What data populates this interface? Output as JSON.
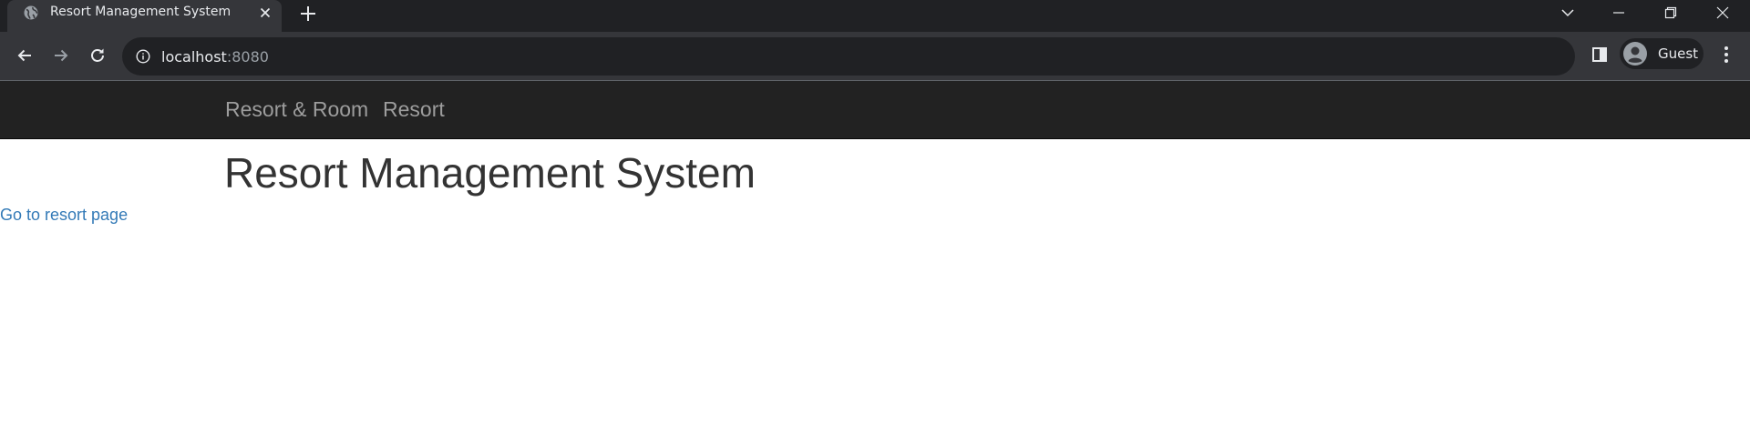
{
  "browser": {
    "tab": {
      "title": "Resort Management System",
      "favicon": "globe-icon"
    },
    "address": {
      "host": "localhost",
      "port": ":8080"
    },
    "profile": {
      "name": "Guest"
    },
    "icons": {
      "back": "arrow-left-icon",
      "forward": "arrow-right-icon",
      "reload": "reload-icon",
      "info": "info-icon",
      "side_panel": "side-panel-icon",
      "menu": "kebab-menu-icon"
    }
  },
  "page": {
    "navbar": {
      "links": [
        {
          "label": "Resort & Room"
        },
        {
          "label": "Resort"
        }
      ]
    },
    "heading": "Resort Management System",
    "resort_link": "Go to resort page"
  },
  "colors": {
    "navbar_bg": "#222222",
    "nav_link": "#9d9d9d",
    "heading": "#333333",
    "link": "#337ab7",
    "chrome_dark": "#202124",
    "chrome_toolbar": "#35363a"
  }
}
